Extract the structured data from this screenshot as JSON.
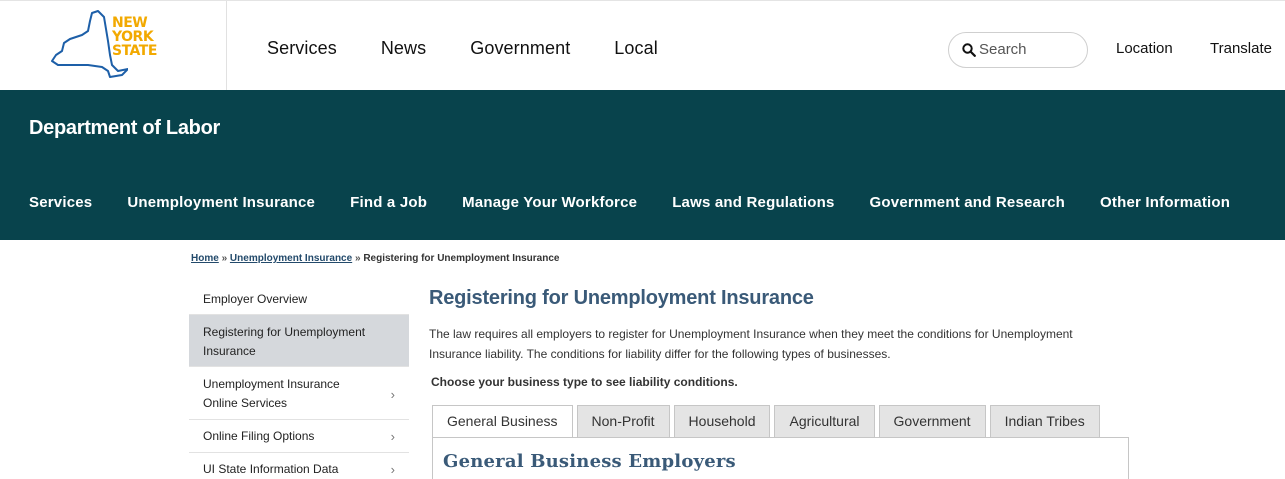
{
  "logo": {
    "lines": [
      "NEW",
      "YORK",
      "STATE"
    ]
  },
  "top_nav": [
    "Services",
    "News",
    "Government",
    "Local"
  ],
  "search": {
    "placeholder": "Search"
  },
  "utility": {
    "location": "Location",
    "translate": "Translate"
  },
  "agency": {
    "title": "Department of Labor"
  },
  "agency_nav": [
    "Services",
    "Unemployment Insurance",
    "Find a Job",
    "Manage Your Workforce",
    "Laws and Regulations",
    "Government and Research",
    "Other Information"
  ],
  "breadcrumb": {
    "home": "Home",
    "sep": "»",
    "section": "Unemployment Insurance",
    "current": "Registering for Unemployment Insurance"
  },
  "sidebar": {
    "items": [
      {
        "label": "Employer Overview",
        "chevron": false,
        "active": false
      },
      {
        "label": "Registering for Unemployment Insurance",
        "chevron": false,
        "active": true
      },
      {
        "label": "Unemployment Insurance Online Services",
        "chevron": true,
        "active": false
      },
      {
        "label": "Online Filing Options",
        "chevron": true,
        "active": false
      },
      {
        "label": "UI State Information Data",
        "chevron": true,
        "active": false
      }
    ],
    "chevron_glyph": "›"
  },
  "main": {
    "title": "Registering for Unemployment Insurance",
    "intro": "The law requires all employers to register for Unemployment Insurance when they meet the conditions for Unemployment Insurance liability. The conditions for liability differ for the following types of businesses.",
    "choose": "Choose your business type to see liability conditions.",
    "tabs": [
      "General Business",
      "Non-Profit",
      "Household",
      "Agricultural",
      "Government",
      "Indian Tribes"
    ],
    "active_tab": "General Business",
    "panel_title": "General Business Employers"
  },
  "colors": {
    "band": "#08434c",
    "logo_gold": "#f2a900",
    "logo_blue": "#1d5fa8",
    "heading_blue": "#3a5a78"
  }
}
